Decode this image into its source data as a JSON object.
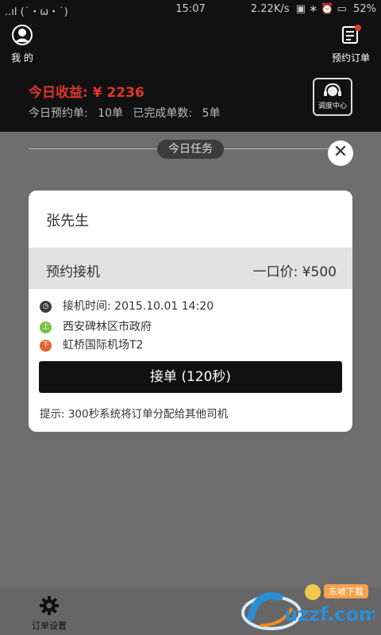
{
  "status_bar": {
    "left": "..ıl (˙・ω・˙)",
    "time": "15:07",
    "net_speed": "2.22K/s",
    "battery": "52%"
  },
  "header": {
    "me_label": "我 的",
    "orders_label": "预约订单",
    "earnings": "今日收益: ¥ 2236",
    "stats": "今日预约单: 10单  已完成单数: 5单",
    "dispatch_label": "调度中心"
  },
  "task_label": "今日任务",
  "card": {
    "passenger": "张先生",
    "type": "预约接机",
    "price": "一口价: ¥500",
    "time": "接机时间: 2015.10.01   14:20",
    "pickup_badge": "上",
    "pickup": "西安碑林区市政府",
    "dropoff_badge": "下",
    "dropoff": "虹桥国际机场T2",
    "accept_button": "接单 (120秒)",
    "hint": "提示: 300秒系统将订单分配给其他司机"
  },
  "footer": {
    "settings_label": "订单设置"
  },
  "watermark": {
    "text": "uzzf.com",
    "tag": "东坡下载"
  },
  "colors": {
    "accent_red": "#e1352b",
    "pickup_green": "#7ac143",
    "dropoff_orange": "#e7602d",
    "overlay": "#6e6e6e"
  }
}
